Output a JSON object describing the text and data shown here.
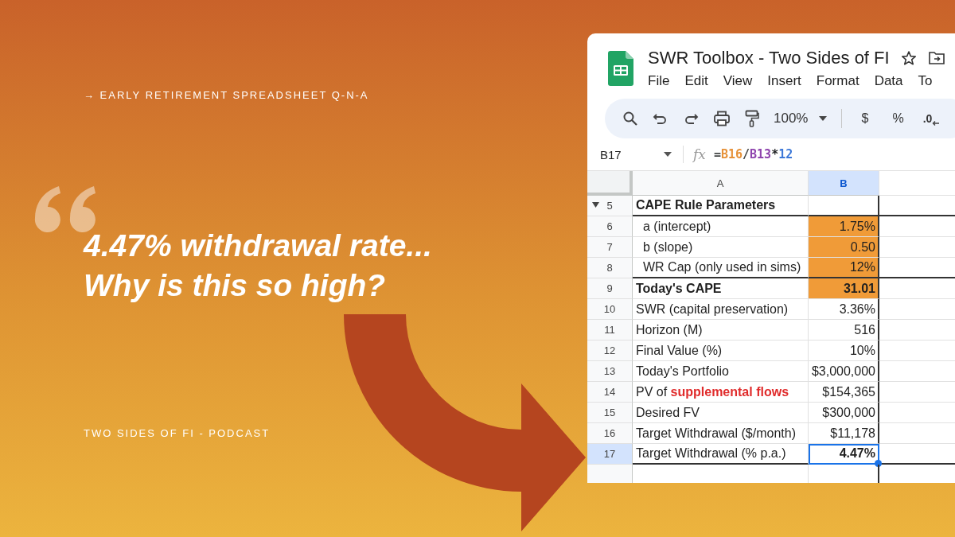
{
  "tagline": "→ EARLY RETIREMENT SPREADSHEET Q-N-A",
  "headline": [
    "4.47% withdrawal rate...",
    "Why is this so high?"
  ],
  "footer": "TWO SIDES OF FI - PODCAST",
  "sheet": {
    "title": "SWR Toolbox - Two Sides of FI",
    "menu": [
      "File",
      "Edit",
      "View",
      "Insert",
      "Format",
      "Data",
      "To"
    ],
    "toolbar": {
      "zoom": "100%",
      "currency": "$",
      "percent": "%",
      "decimal": ".0"
    },
    "name_box": "B17",
    "function_label": "fx",
    "formula": [
      {
        "text": "=",
        "color": "#444746"
      },
      {
        "text": "B16",
        "color": "#e69138"
      },
      {
        "text": "/",
        "color": "#444746"
      },
      {
        "text": "B13",
        "color": "#8e44ad"
      },
      {
        "text": "*",
        "color": "#202124"
      },
      {
        "text": "12",
        "color": "#3c78d8"
      }
    ],
    "columns": [
      {
        "label": "A",
        "selected": false
      },
      {
        "label": "B",
        "selected": true
      }
    ],
    "rows": [
      {
        "number": "5",
        "a": "CAPE Rule Parameters",
        "bold": true,
        "indented": false,
        "input": false,
        "border_below": true,
        "selected": false,
        "expanded": true
      },
      {
        "number": "6",
        "a": "a (intercept)",
        "b": "1.75%",
        "bold": false,
        "indented": true,
        "input": true,
        "border_below": false,
        "selected": false
      },
      {
        "number": "7",
        "a": "b (slope)",
        "b": "0.50",
        "bold": false,
        "indented": true,
        "input": true,
        "border_below": false,
        "selected": false
      },
      {
        "number": "8",
        "a": "WR Cap (only used in sims)",
        "b": "12%",
        "bold": false,
        "indented": true,
        "input": true,
        "border_below": true,
        "selected": false
      },
      {
        "number": "9",
        "a": "Today's CAPE",
        "b": "31.01",
        "bold": true,
        "indented": false,
        "input": true,
        "border_below": false,
        "selected": false
      },
      {
        "number": "10",
        "a": "SWR (capital preservation)",
        "b": "3.36%",
        "bold": false,
        "indented": false,
        "input": false,
        "border_below": false,
        "selected": false
      },
      {
        "number": "11",
        "a": "Horizon (M)",
        "b": "516",
        "bold": false,
        "indented": false,
        "input": false,
        "border_below": false,
        "selected": false
      },
      {
        "number": "12",
        "a": "Final Value (%)",
        "b": "10%",
        "bold": false,
        "indented": false,
        "input": false,
        "border_below": false,
        "selected": false
      },
      {
        "number": "13",
        "a": "Today's Portfolio",
        "b": "$3,000,000",
        "bold": false,
        "indented": false,
        "input": false,
        "border_below": false,
        "selected": false
      },
      {
        "number": "14",
        "a": "PV of **supplemental flows**",
        "b": "$154,365",
        "bold": false,
        "indented": false,
        "input": false,
        "border_below": false,
        "selected": false
      },
      {
        "number": "15",
        "a": "Desired FV",
        "b": "$300,000",
        "bold": false,
        "indented": false,
        "input": false,
        "border_below": false,
        "selected": false
      },
      {
        "number": "16",
        "a": "Target Withdrawal ($/month)",
        "b": "$11,178",
        "bold": false,
        "indented": false,
        "input": false,
        "border_below": false,
        "selected": false
      },
      {
        "number": "17",
        "a": "Target Withdrawal (% p.a.)",
        "b": "4.47%",
        "bold": false,
        "value_bold": true,
        "indented": false,
        "input": false,
        "border_below": true,
        "selected": true
      }
    ]
  }
}
